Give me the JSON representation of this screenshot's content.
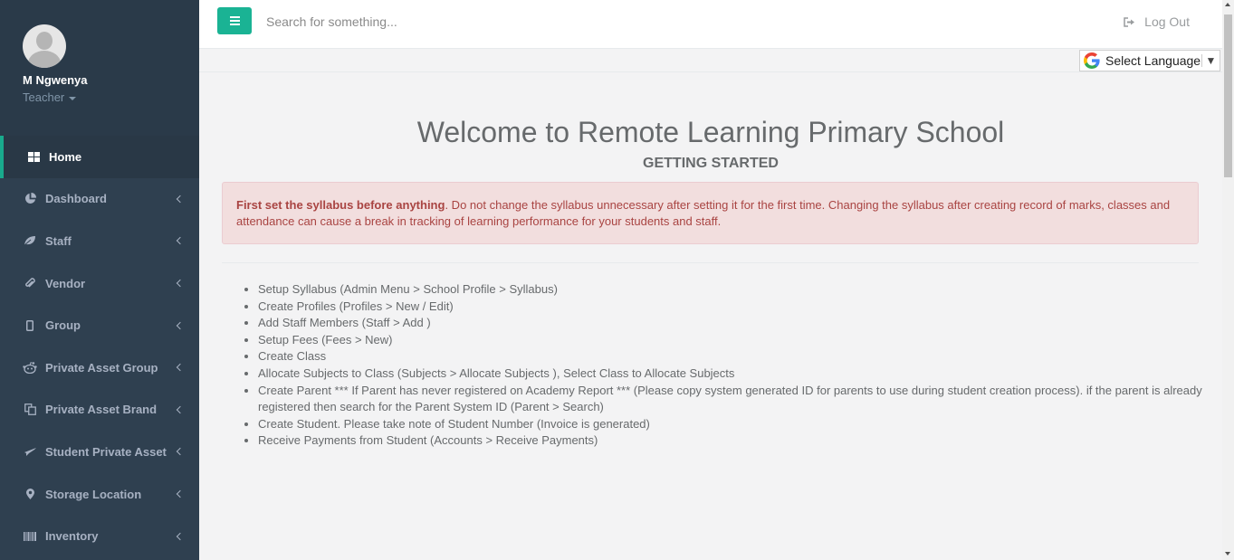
{
  "user": {
    "name": "M Ngwenya",
    "role": "Teacher"
  },
  "sidebar": {
    "items": [
      {
        "label": "Home",
        "icon": "grid-icon",
        "active": true
      },
      {
        "label": "Dashboard",
        "icon": "pie-chart-icon"
      },
      {
        "label": "Staff",
        "icon": "leaf-icon"
      },
      {
        "label": "Vendor",
        "icon": "paperclip-icon"
      },
      {
        "label": "Group",
        "icon": "phone-icon"
      },
      {
        "label": "Private Asset Group",
        "icon": "reddit-icon"
      },
      {
        "label": "Private Asset Brand",
        "icon": "copy-icon"
      },
      {
        "label": "Student Private Asset",
        "icon": "plane-icon"
      },
      {
        "label": "Storage Location",
        "icon": "map-marker-icon"
      },
      {
        "label": "Inventory",
        "icon": "barcode-icon"
      }
    ]
  },
  "topbar": {
    "search_placeholder": "Search for something...",
    "logout_label": "Log Out"
  },
  "language": {
    "label": "Select Language"
  },
  "main": {
    "title": "Welcome to Remote Learning Primary School",
    "subtitle": "GETTING STARTED",
    "alert_bold": "First set the syllabus before anything",
    "alert_text": ". Do not change the syllabus unnecessary after setting it for the first time. Changing the syllabus after creating record of marks, classes and attendance can cause a break in tracking of learning performance for your students and staff.",
    "steps": [
      "Setup Syllabus (Admin Menu > School Profile > Syllabus)",
      "Create Profiles (Profiles > New / Edit)",
      "Add Staff Members (Staff > Add )",
      "Setup Fees (Fees > New)",
      "Create Class",
      "Allocate Subjects to Class (Subjects > Allocate Subjects ), Select Class to Allocate Subjects",
      "Create Parent *** If Parent has never registered on Academy Report *** (Please copy system generated ID for parents to use during student creation process). if the parent is already registered then search for the Parent System ID (Parent > Search)",
      "Create Student. Please take note of Student Number (Invoice is generated)",
      "Receive Payments from Student (Accounts > Receive Payments)"
    ]
  },
  "colors": {
    "sidebar": "#2f4050",
    "accent": "#1ab394",
    "alert_bg": "#f2dede",
    "alert_text": "#a94442"
  }
}
